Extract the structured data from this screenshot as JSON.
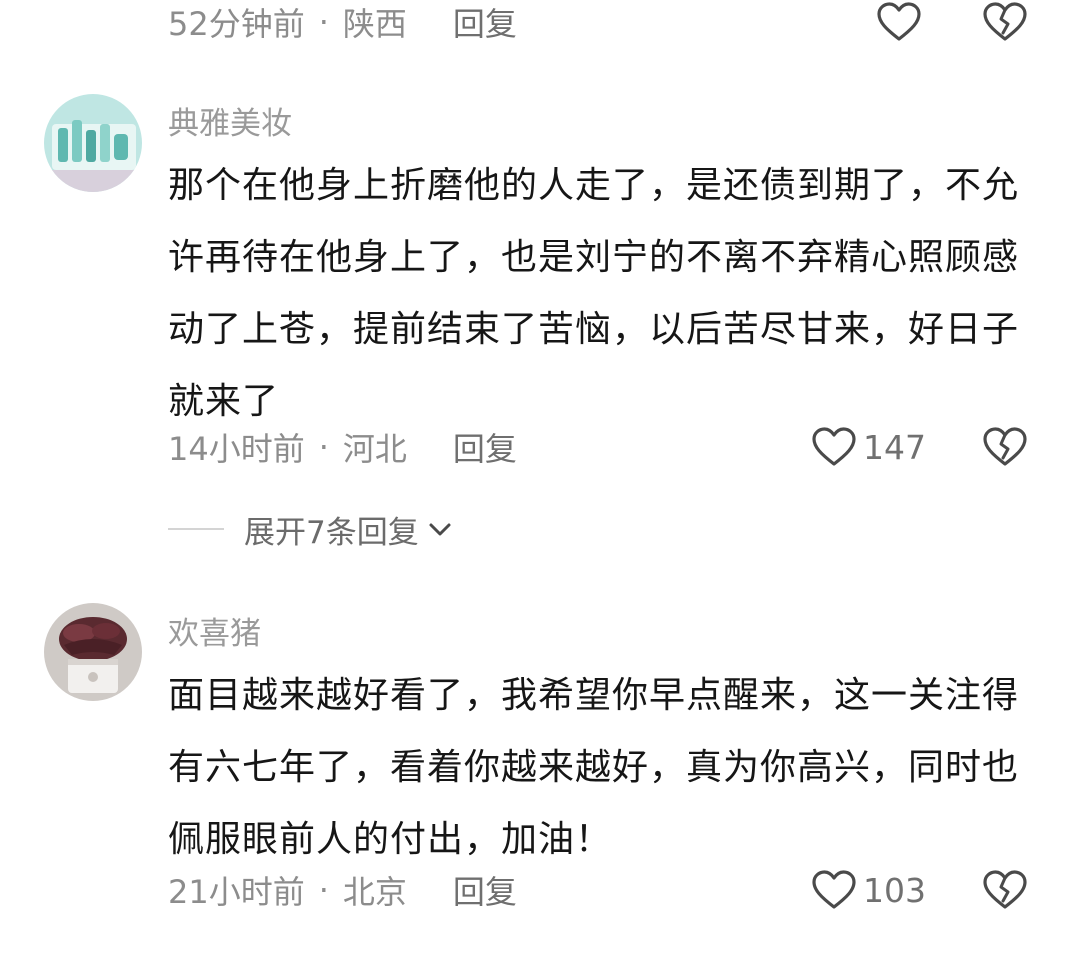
{
  "top_meta": {
    "time": "52分钟前",
    "location": "陕西",
    "reply_label": "回复"
  },
  "comments": [
    {
      "username": "典雅美妆",
      "text": "那个在他身上折磨他的人走了，是还债到期了，不允许再待在他身上了，也是刘宁的不离不弃精心照顾感动了上苍，提前结束了苦恼，以后苦尽甘来，好日子就来了",
      "time": "14小时前",
      "location": "河北",
      "reply_label": "回复",
      "likes": "147",
      "expand_label": "展开7条回复"
    },
    {
      "username": "欢喜猪",
      "text": "面目越来越好看了，我希望你早点醒来，这一关注得有六七年了，看着你越来越好，真为你高兴，同时也佩服眼前人的付出，加油！",
      "time": "21小时前",
      "location": "北京",
      "reply_label": "回复",
      "likes": "103"
    }
  ],
  "icons": {
    "like": "heart-icon",
    "dislike": "broken-heart-icon",
    "expand": "chevron-down-icon"
  },
  "colors": {
    "meta_text": "#8c8c8c",
    "username": "#9a9a9a",
    "content": "#161616",
    "icon": "#4a4a4a"
  }
}
